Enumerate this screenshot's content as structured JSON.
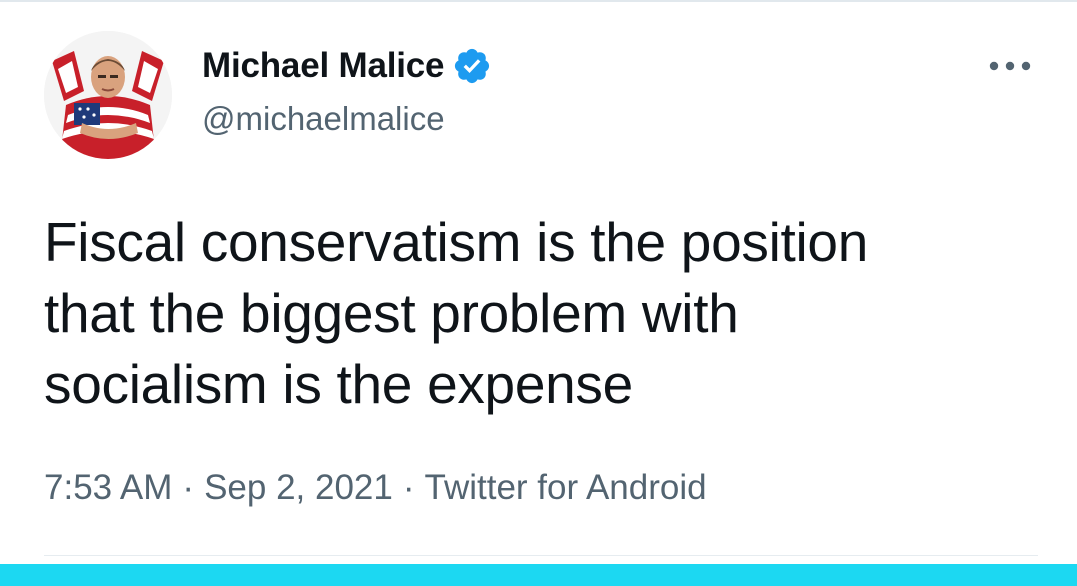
{
  "author": {
    "name": "Michael Malice",
    "handle": "@michaelmalice",
    "verified": true
  },
  "tweet": {
    "text_lines": [
      "Fiscal conservatism is the position",
      "that the biggest problem with",
      "socialism is the expense"
    ]
  },
  "meta": {
    "time": "7:53 AM",
    "date": "Sep 2, 2021",
    "source": "Twitter for Android",
    "separator": "·"
  },
  "icons": {
    "verified": "verified-badge-icon",
    "more": "more-horizontal-icon"
  },
  "colors": {
    "verified_blue": "#1d9bf0",
    "text_primary": "#0f1419",
    "text_secondary": "#536471",
    "bottom_bar": "#1cd8f2"
  }
}
